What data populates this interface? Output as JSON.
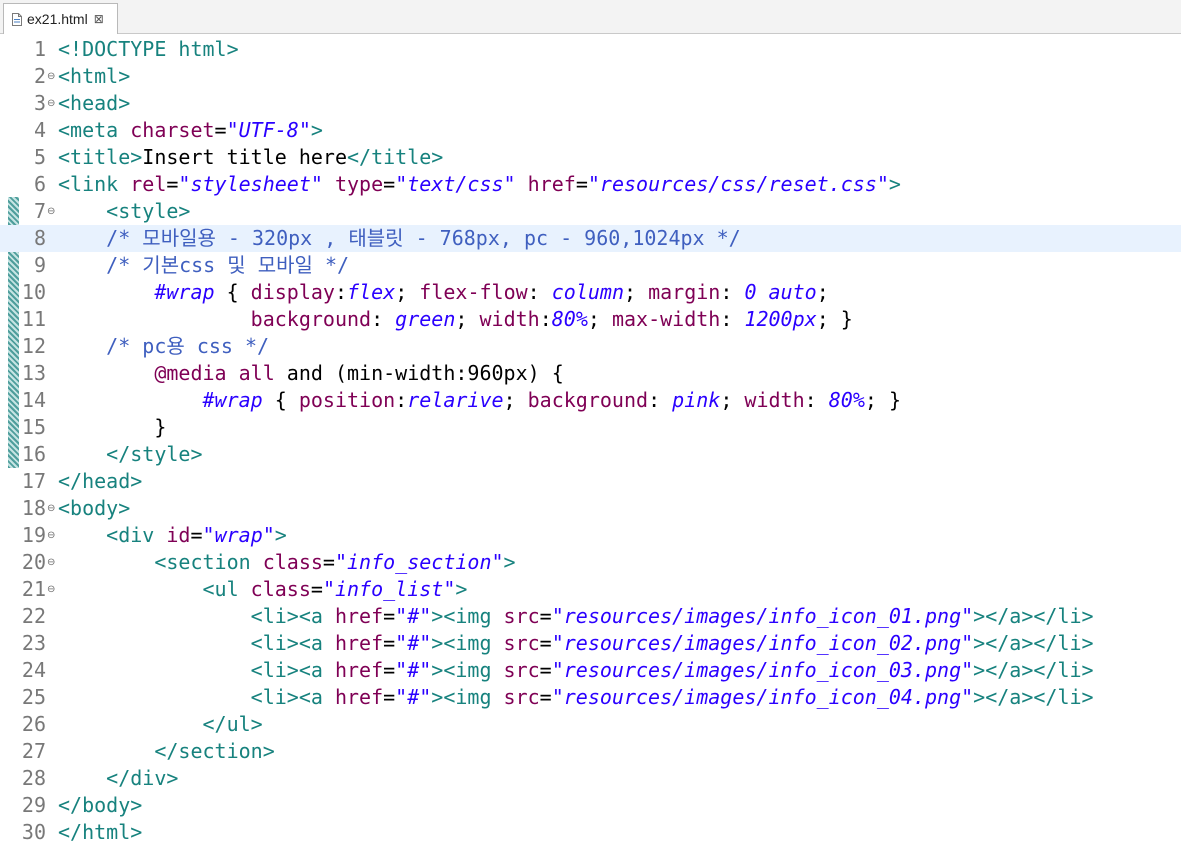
{
  "tab": {
    "filename": "ex21.html",
    "close_glyph": "⊠",
    "icon": "html-file-icon"
  },
  "editor": {
    "lines": [
      {
        "n": "1",
        "fold": "",
        "tokens": [
          [
            "t",
            "<!DOCTYPE html>"
          ]
        ]
      },
      {
        "n": "2",
        "fold": "⊖",
        "tokens": [
          [
            "t",
            "<html>"
          ]
        ]
      },
      {
        "n": "3",
        "fold": "⊖",
        "tokens": [
          [
            "t",
            "<head>"
          ]
        ]
      },
      {
        "n": "4",
        "fold": "",
        "tokens": [
          [
            "t",
            "<meta "
          ],
          [
            "a",
            "charset"
          ],
          [
            "p",
            "="
          ],
          [
            "s",
            "\"UTF-8\""
          ],
          [
            "t",
            ">"
          ]
        ]
      },
      {
        "n": "5",
        "fold": "",
        "tokens": [
          [
            "t",
            "<title>"
          ],
          [
            "p",
            "Insert title here"
          ],
          [
            "t",
            "</title>"
          ]
        ]
      },
      {
        "n": "6",
        "fold": "",
        "tokens": [
          [
            "t",
            "<link "
          ],
          [
            "a",
            "rel"
          ],
          [
            "p",
            "="
          ],
          [
            "s",
            "\"stylesheet\""
          ],
          [
            "p",
            " "
          ],
          [
            "a",
            "type"
          ],
          [
            "p",
            "="
          ],
          [
            "s",
            "\"text/css\""
          ],
          [
            "p",
            " "
          ],
          [
            "a",
            "href"
          ],
          [
            "p",
            "="
          ],
          [
            "s",
            "\"resources/css/reset.css\""
          ],
          [
            "t",
            ">"
          ]
        ]
      },
      {
        "n": "7",
        "fold": "⊖",
        "tokens": [
          [
            "p",
            "    "
          ],
          [
            "t",
            "<style>"
          ]
        ]
      },
      {
        "n": "8",
        "fold": "",
        "current": true,
        "tokens": [
          [
            "p",
            "    "
          ],
          [
            "c",
            "/* 모바일용 - 320px , 태블릿 - 768px, pc - 960,1024px */"
          ]
        ]
      },
      {
        "n": "9",
        "fold": "",
        "tokens": [
          [
            "p",
            "    "
          ],
          [
            "c",
            "/* 기본css 및 모바일 */"
          ]
        ]
      },
      {
        "n": "10",
        "fold": "",
        "tokens": [
          [
            "p",
            "        "
          ],
          [
            "s",
            "#wrap"
          ],
          [
            "p",
            " { "
          ],
          [
            "a",
            "display"
          ],
          [
            "p",
            ":"
          ],
          [
            "s",
            "flex"
          ],
          [
            "p",
            "; "
          ],
          [
            "a",
            "flex-flow"
          ],
          [
            "p",
            ": "
          ],
          [
            "s",
            "column"
          ],
          [
            "p",
            "; "
          ],
          [
            "a",
            "margin"
          ],
          [
            "p",
            ": "
          ],
          [
            "s",
            "0 auto"
          ],
          [
            "p",
            ";"
          ]
        ]
      },
      {
        "n": "11",
        "fold": "",
        "tokens": [
          [
            "p",
            "                "
          ],
          [
            "a",
            "background"
          ],
          [
            "p",
            ": "
          ],
          [
            "s",
            "green"
          ],
          [
            "p",
            "; "
          ],
          [
            "a",
            "width"
          ],
          [
            "p",
            ":"
          ],
          [
            "s",
            "80%"
          ],
          [
            "p",
            "; "
          ],
          [
            "a",
            "max-width"
          ],
          [
            "p",
            ": "
          ],
          [
            "s",
            "1200px"
          ],
          [
            "p",
            "; }"
          ]
        ]
      },
      {
        "n": "12",
        "fold": "",
        "tokens": [
          [
            "p",
            "    "
          ],
          [
            "c",
            "/* pc용 css */"
          ]
        ]
      },
      {
        "n": "13",
        "fold": "",
        "tokens": [
          [
            "p",
            "        "
          ],
          [
            "a",
            "@media"
          ],
          [
            "p",
            " "
          ],
          [
            "a",
            "all"
          ],
          [
            "p",
            " and (min-width:960px) {"
          ]
        ]
      },
      {
        "n": "14",
        "fold": "",
        "tokens": [
          [
            "p",
            "            "
          ],
          [
            "s",
            "#wrap"
          ],
          [
            "p",
            " { "
          ],
          [
            "a",
            "position"
          ],
          [
            "p",
            ":"
          ],
          [
            "s",
            "relarive"
          ],
          [
            "p",
            "; "
          ],
          [
            "a",
            "background"
          ],
          [
            "p",
            ": "
          ],
          [
            "s",
            "pink"
          ],
          [
            "p",
            "; "
          ],
          [
            "a",
            "width"
          ],
          [
            "p",
            ": "
          ],
          [
            "s",
            "80%"
          ],
          [
            "p",
            "; }"
          ]
        ]
      },
      {
        "n": "15",
        "fold": "",
        "tokens": [
          [
            "p",
            "        }"
          ]
        ]
      },
      {
        "n": "16",
        "fold": "",
        "tokens": [
          [
            "p",
            "    "
          ],
          [
            "t",
            "</style>"
          ]
        ]
      },
      {
        "n": "17",
        "fold": "",
        "tokens": [
          [
            "t",
            "</head>"
          ]
        ]
      },
      {
        "n": "18",
        "fold": "⊖",
        "tokens": [
          [
            "t",
            "<body>"
          ]
        ]
      },
      {
        "n": "19",
        "fold": "⊖",
        "tokens": [
          [
            "p",
            "    "
          ],
          [
            "t",
            "<div "
          ],
          [
            "a",
            "id"
          ],
          [
            "p",
            "="
          ],
          [
            "s",
            "\"wrap\""
          ],
          [
            "t",
            ">"
          ]
        ]
      },
      {
        "n": "20",
        "fold": "⊖",
        "tokens": [
          [
            "p",
            "        "
          ],
          [
            "t",
            "<section "
          ],
          [
            "a",
            "class"
          ],
          [
            "p",
            "="
          ],
          [
            "s",
            "\"info_section\""
          ],
          [
            "t",
            ">"
          ]
        ]
      },
      {
        "n": "21",
        "fold": "⊖",
        "tokens": [
          [
            "p",
            "            "
          ],
          [
            "t",
            "<ul "
          ],
          [
            "a",
            "class"
          ],
          [
            "p",
            "="
          ],
          [
            "s",
            "\"info_list\""
          ],
          [
            "t",
            ">"
          ]
        ]
      },
      {
        "n": "22",
        "fold": "",
        "tokens": [
          [
            "p",
            "                "
          ],
          [
            "t",
            "<li><a "
          ],
          [
            "a",
            "href"
          ],
          [
            "p",
            "="
          ],
          [
            "s",
            "\"#\""
          ],
          [
            "t",
            "><img "
          ],
          [
            "a",
            "src"
          ],
          [
            "p",
            "="
          ],
          [
            "s",
            "\"resources/images/info_icon_01.png\""
          ],
          [
            "t",
            "></a></li>"
          ]
        ]
      },
      {
        "n": "23",
        "fold": "",
        "tokens": [
          [
            "p",
            "                "
          ],
          [
            "t",
            "<li><a "
          ],
          [
            "a",
            "href"
          ],
          [
            "p",
            "="
          ],
          [
            "s",
            "\"#\""
          ],
          [
            "t",
            "><img "
          ],
          [
            "a",
            "src"
          ],
          [
            "p",
            "="
          ],
          [
            "s",
            "\"resources/images/info_icon_02.png\""
          ],
          [
            "t",
            "></a></li>"
          ]
        ]
      },
      {
        "n": "24",
        "fold": "",
        "tokens": [
          [
            "p",
            "                "
          ],
          [
            "t",
            "<li><a "
          ],
          [
            "a",
            "href"
          ],
          [
            "p",
            "="
          ],
          [
            "s",
            "\"#\""
          ],
          [
            "t",
            "><img "
          ],
          [
            "a",
            "src"
          ],
          [
            "p",
            "="
          ],
          [
            "s",
            "\"resources/images/info_icon_03.png\""
          ],
          [
            "t",
            "></a></li>"
          ]
        ]
      },
      {
        "n": "25",
        "fold": "",
        "tokens": [
          [
            "p",
            "                "
          ],
          [
            "t",
            "<li><a "
          ],
          [
            "a",
            "href"
          ],
          [
            "p",
            "="
          ],
          [
            "s",
            "\"#\""
          ],
          [
            "t",
            "><img "
          ],
          [
            "a",
            "src"
          ],
          [
            "p",
            "="
          ],
          [
            "s",
            "\"resources/images/info_icon_04.png\""
          ],
          [
            "t",
            "></a></li>"
          ]
        ]
      },
      {
        "n": "26",
        "fold": "",
        "tokens": [
          [
            "p",
            "            "
          ],
          [
            "t",
            "</ul>"
          ]
        ]
      },
      {
        "n": "27",
        "fold": "",
        "tokens": [
          [
            "p",
            "        "
          ],
          [
            "t",
            "</section>"
          ]
        ]
      },
      {
        "n": "28",
        "fold": "",
        "tokens": [
          [
            "p",
            "    "
          ],
          [
            "t",
            "</div>"
          ]
        ]
      },
      {
        "n": "29",
        "fold": "",
        "tokens": [
          [
            "t",
            "</body>"
          ]
        ]
      },
      {
        "n": "30",
        "fold": "",
        "tokens": [
          [
            "t",
            "</html>"
          ]
        ]
      }
    ]
  },
  "colors": {
    "tag": "#17827e",
    "attribute": "#7f0055",
    "string": "#2a00ff",
    "comment": "#3f5fbf",
    "current_line": "#e8f2fe",
    "change_bar": "#4e9e9c"
  }
}
